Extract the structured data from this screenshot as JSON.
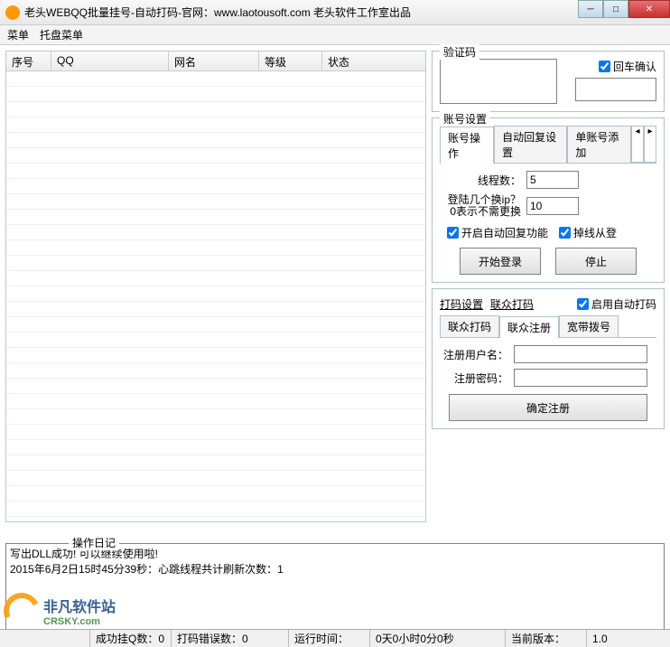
{
  "window": {
    "title": "老头WEBQQ批量挂号-自动打码-官网：www.laotousoft.com 老头软件工作室出品"
  },
  "menubar": {
    "menu": "菜单",
    "tray": "托盘菜单"
  },
  "table": {
    "cols": {
      "seq": "序号",
      "qq": "QQ",
      "nick": "网名",
      "level": "等级",
      "status": "状态"
    }
  },
  "captcha": {
    "legend": "验证码",
    "enter_confirm": "回车确认"
  },
  "account": {
    "legend": "账号设置",
    "tabs": {
      "ops": "账号操作",
      "autoReply": "自动回复设置",
      "addSingle": "单账号添加"
    },
    "threads_label": "线程数：",
    "threads_value": "5",
    "switchip_label1": "登陆几个换ip？",
    "switchip_label2": "0表示不需更换",
    "switchip_value": "10",
    "chk_autoReply": "开启自动回复功能",
    "chk_relogin": "掉线从登",
    "btn_start": "开始登录",
    "btn_stop": "停止"
  },
  "dama": {
    "hdr1": "打码设置",
    "hdr2": "联众打码",
    "chk_enable": "启用自动打码",
    "tabs": {
      "lzdm": "联众打码",
      "lzreg": "联众注册",
      "kbbh": "宽带拨号"
    },
    "user_label": "注册用户名：",
    "pass_label": "注册密码：",
    "btn_reg": "确定注册"
  },
  "log": {
    "legend": "操作日记",
    "line1": "写出DLL成功! 可以继续使用啦!",
    "line2": "2015年6月2日15时45分39秒：心跳线程共计刷新次数：1"
  },
  "status": {
    "online": "成功挂Q数：",
    "online_v": "0",
    "err": "打码错误数：",
    "err_v": "0",
    "runtime": "运行时间：",
    "runtime_v": "0天0小时0分0秒",
    "ver": "当前版本：",
    "ver_v": "1.0"
  },
  "watermark": {
    "name": "非凡软件站",
    "domain": "CRSKY.com"
  }
}
